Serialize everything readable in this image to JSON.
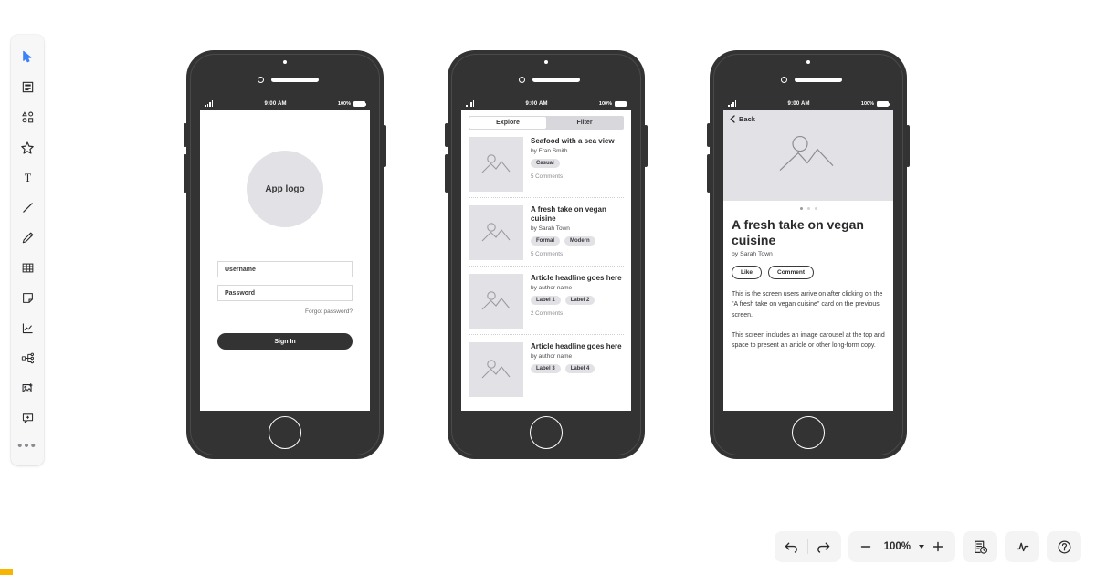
{
  "left_toolbar": {
    "items": [
      {
        "icon": "cursor-select-icon",
        "name": "select-tool",
        "active": true
      },
      {
        "icon": "frame-icon",
        "name": "frame-tool",
        "active": false
      },
      {
        "icon": "shapes-icon",
        "name": "shapes-tool",
        "active": false
      },
      {
        "icon": "star-icon",
        "name": "star-tool",
        "active": false
      },
      {
        "icon": "text-icon",
        "name": "text-tool",
        "active": false,
        "label": "T"
      },
      {
        "icon": "line-icon",
        "name": "line-tool",
        "active": false
      },
      {
        "icon": "pencil-icon",
        "name": "pencil-tool",
        "active": false
      },
      {
        "icon": "table-icon",
        "name": "table-tool",
        "active": false
      },
      {
        "icon": "sticky-note-icon",
        "name": "sticky-note-tool",
        "active": false
      },
      {
        "icon": "chart-icon",
        "name": "chart-tool",
        "active": false
      },
      {
        "icon": "mindmap-icon",
        "name": "mindmap-tool",
        "active": false
      },
      {
        "icon": "add-image-icon",
        "name": "image-tool",
        "active": false
      },
      {
        "icon": "add-comment-icon",
        "name": "comment-tool",
        "active": false
      }
    ],
    "more_label": "•••"
  },
  "status_bar": {
    "time": "9:00 AM",
    "battery_percent": "100%"
  },
  "screens": {
    "login": {
      "logo_text": "App logo",
      "username_placeholder": "Username",
      "password_placeholder": "Password",
      "forgot_label": "Forgot password?",
      "signin_label": "Sign In"
    },
    "list": {
      "tabs": [
        {
          "label": "Explore",
          "active": true
        },
        {
          "label": "Filter",
          "active": false
        }
      ],
      "cards": [
        {
          "title": "Seafood with a sea view",
          "author": "by Fran Smith",
          "tags": [
            "Casual"
          ],
          "comments": "5 Comments"
        },
        {
          "title": "A fresh take on vegan cuisine",
          "author": "by Sarah Town",
          "tags": [
            "Formal",
            "Modern"
          ],
          "comments": "5 Comments"
        },
        {
          "title": "Article headline goes here",
          "author": "by author name",
          "tags": [
            "Label 1",
            "Label 2"
          ],
          "comments": "2 Comments"
        },
        {
          "title": "Article headline goes here",
          "author": "by author name",
          "tags": [
            "Label 3",
            "Label 4"
          ],
          "comments": ""
        }
      ]
    },
    "article": {
      "back_label": "Back",
      "carousel_dots": 3,
      "carousel_active_index": 0,
      "title": "A fresh take on vegan cuisine",
      "author": "by Sarah Town",
      "like_label": "Like",
      "comment_label": "Comment",
      "paragraph_1": "This is the screen users arrive on after clicking on the \"A fresh take on vegan cuisine\" card on the previous screen.",
      "paragraph_2": "This screen includes an image carousel at the top and space to present an article or other long-form copy."
    }
  },
  "bottom_toolbar": {
    "undo": "undo-icon",
    "redo": "redo-icon",
    "zoom_out": "minus-icon",
    "zoom_level": "100%",
    "zoom_in": "plus-icon",
    "history": "version-history-icon",
    "activity": "activity-icon",
    "help": "help-icon"
  },
  "colors": {
    "accent": "#3b82f6",
    "frame": "#333333",
    "placeholder": "#e2e2e6",
    "toolbar_bg": "#f4f4f5"
  }
}
